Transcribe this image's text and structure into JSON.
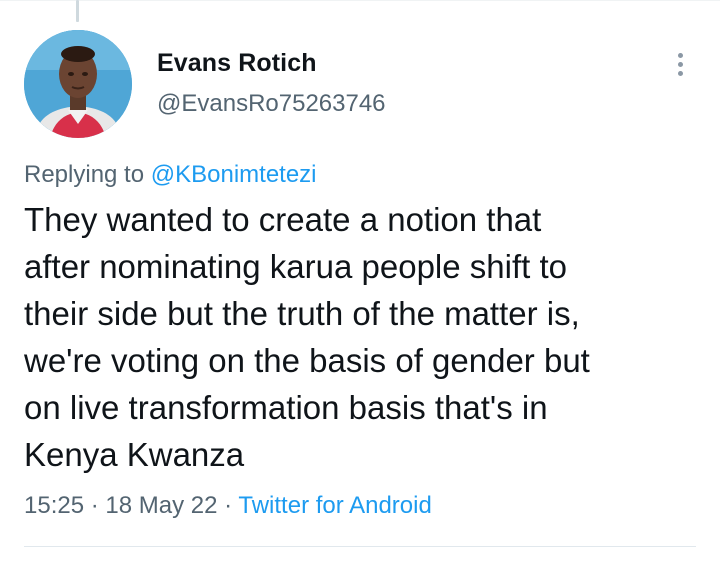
{
  "tweet": {
    "display_name": "Evans Rotich",
    "handle": "@EvansRo75263746",
    "replying_prefix": "Replying to",
    "replying_to": "@KBonimtetezi",
    "text_lines": [
      "They wanted to create a notion that",
      "after nominating karua people shift to",
      "their side but the truth of the matter is,",
      "we're voting on the basis of gender but",
      "on live transformation basis that's in",
      "Kenya Kwanza"
    ],
    "time": "15:25",
    "separator": "·",
    "date": "18 May 22",
    "source": "Twitter for Android"
  },
  "icons": {
    "more": "more-vertical-icon",
    "avatar": "user-avatar"
  },
  "colors": {
    "text": "#0f1419",
    "secondary_text": "#536471",
    "link": "#1d9bf0",
    "divider": "#e1e8ed"
  }
}
